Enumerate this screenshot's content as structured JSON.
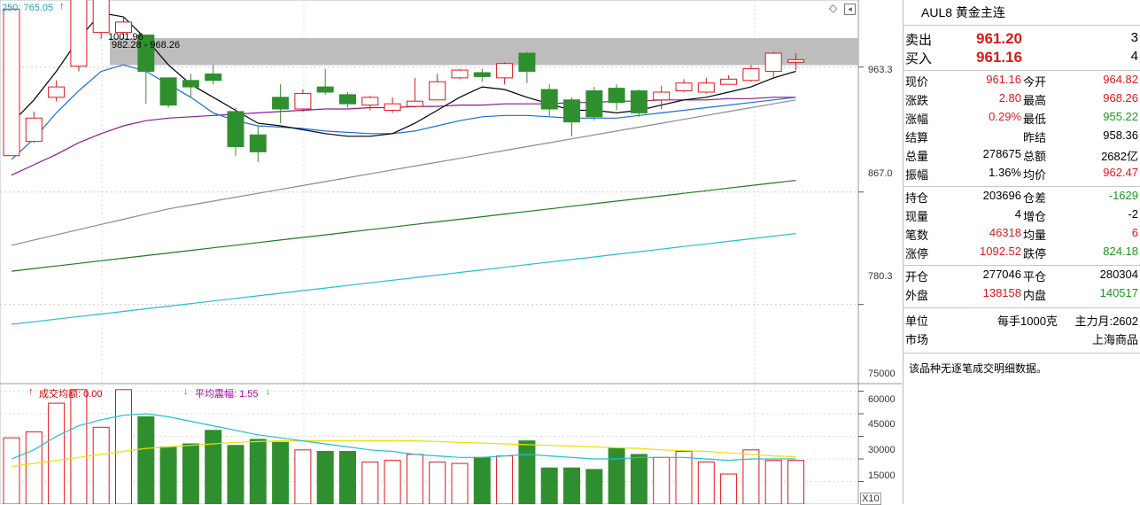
{
  "price_panel": {
    "corner_text": "250: 765.05",
    "peak_label": "1001.96",
    "range_label": "982.28 - 968.26",
    "y_ticks": [
      "963.3",
      "867.0",
      "780.3"
    ]
  },
  "volume_panel": {
    "label_turnover": "成交均额: 0.00",
    "label_amplitude": "平均震幅: 1.55",
    "y_ticks": [
      "75000",
      "60000",
      "45000",
      "30000",
      "15000"
    ],
    "multiplier": "X10"
  },
  "quote": {
    "title": "AUL8  黄金主连",
    "sell_label": "卖出",
    "sell_price": "961.20",
    "sell_qty": "3",
    "buy_label": "买入",
    "buy_price": "961.16",
    "buy_qty": "4",
    "rows1": [
      {
        "l1": "现价",
        "v1": "961.16",
        "c1": "red",
        "l2": "今开",
        "v2": "964.82",
        "c2": "red"
      },
      {
        "l1": "涨跌",
        "v1": "2.80",
        "c1": "red",
        "l2": "最高",
        "v2": "968.26",
        "c2": "red"
      },
      {
        "l1": "涨幅",
        "v1": "0.29%",
        "c1": "red",
        "l2": "最低",
        "v2": "955.22",
        "c2": "green"
      },
      {
        "l1": "结算",
        "v1": "",
        "c1": "",
        "l2": "昨结",
        "v2": "958.36",
        "c2": ""
      },
      {
        "l1": "总量",
        "v1": "278675",
        "c1": "",
        "l2": "总额",
        "v2": "2682亿",
        "c2": ""
      },
      {
        "l1": "振幅",
        "v1": "1.36%",
        "c1": "",
        "l2": "均价",
        "v2": "962.47",
        "c2": "red"
      }
    ],
    "rows2": [
      {
        "l1": "持仓",
        "v1": "203696",
        "c1": "",
        "l2": "仓差",
        "v2": "-1629",
        "c2": "green"
      },
      {
        "l1": "现量",
        "v1": "4",
        "c1": "",
        "l2": "增仓",
        "v2": "-2",
        "c2": ""
      },
      {
        "l1": "笔数",
        "v1": "46318",
        "c1": "red",
        "l2": "均量",
        "v2": "6",
        "c2": "red"
      },
      {
        "l1": "涨停",
        "v1": "1092.52",
        "c1": "red",
        "l2": "跌停",
        "v2": "824.18",
        "c2": "green"
      }
    ],
    "rows3": [
      {
        "l1": "开仓",
        "v1": "277046",
        "c1": "",
        "l2": "平仓",
        "v2": "280304",
        "c2": ""
      },
      {
        "l1": "外盘",
        "v1": "138158",
        "c1": "red",
        "l2": "内盘",
        "v2": "140517",
        "c2": "green"
      }
    ],
    "unit_label": "单位",
    "unit_value": "每手1000克",
    "main_month": "主力月:2602",
    "market_label": "市场",
    "market_value": "上海商品",
    "note": "该品种无逐笔成交明细数据。"
  },
  "chart_data": {
    "type": "candlestick",
    "y_range": [
      720,
      1015
    ],
    "candles": [
      [
        895,
        1008,
        1008,
        895
      ],
      [
        906,
        924,
        929,
        905
      ],
      [
        940,
        948,
        953,
        937
      ],
      [
        964,
        1040,
        1042,
        960
      ],
      [
        990,
        1025,
        1029,
        985
      ],
      [
        990,
        998,
        1002,
        985
      ],
      [
        988,
        960,
        960,
        935
      ],
      [
        955,
        934,
        934,
        932
      ],
      [
        953,
        948,
        958,
        940
      ],
      [
        958,
        953,
        965,
        950
      ],
      [
        929,
        902,
        932,
        895
      ],
      [
        911,
        898,
        918,
        890
      ],
      [
        940,
        931,
        950,
        920
      ],
      [
        931,
        943,
        946,
        929
      ],
      [
        948,
        944,
        962,
        942
      ],
      [
        942,
        935,
        944,
        932
      ],
      [
        934,
        940,
        941,
        930
      ],
      [
        930,
        935,
        940,
        928
      ],
      [
        933,
        937,
        955,
        932
      ],
      [
        938,
        952,
        958,
        938
      ],
      [
        955,
        961,
        962,
        954
      ],
      [
        959,
        956,
        962,
        952
      ],
      [
        955,
        966,
        967,
        950
      ],
      [
        974,
        960,
        975,
        951
      ],
      [
        946,
        931,
        950,
        925
      ],
      [
        938,
        921,
        940,
        910
      ],
      [
        945,
        925,
        948,
        922
      ],
      [
        947,
        936,
        950,
        930
      ],
      [
        945,
        928,
        946,
        925
      ],
      [
        938,
        944,
        949,
        931
      ],
      [
        945,
        951,
        954,
        944
      ],
      [
        944,
        951,
        955,
        943
      ],
      [
        950,
        954,
        957,
        951
      ],
      [
        953,
        962,
        965,
        952
      ],
      [
        960,
        974,
        975,
        954
      ],
      [
        967,
        969,
        974,
        961
      ]
    ],
    "ma_short": [
      920,
      938,
      960,
      985,
      1005,
      1002,
      985,
      965,
      950,
      940,
      930,
      920,
      918,
      915,
      912,
      910,
      910,
      912,
      920,
      930,
      940,
      948,
      946,
      940,
      935,
      930,
      930,
      928,
      930,
      934,
      938,
      940,
      944,
      948,
      955,
      960
    ],
    "ma_mid": [
      892,
      908,
      928,
      945,
      960,
      965,
      960,
      950,
      940,
      928,
      922,
      918,
      917,
      916,
      914,
      913,
      912,
      912,
      914,
      918,
      922,
      925,
      926,
      926,
      925,
      924,
      924,
      924,
      926,
      928,
      930,
      932,
      934,
      936,
      938,
      940
    ],
    "ma_long": [
      880,
      888,
      896,
      905,
      912,
      918,
      922,
      924,
      925,
      926,
      927,
      928,
      929,
      930,
      931,
      931,
      932,
      932,
      933,
      933,
      934,
      934,
      935,
      935,
      935,
      936,
      936,
      937,
      937,
      938,
      938,
      938,
      939,
      939,
      940,
      940
    ],
    "ma_120": [
      826,
      830,
      834,
      838,
      842,
      846,
      850,
      854,
      857,
      860,
      863,
      866,
      869,
      872,
      875,
      878,
      881,
      884,
      887,
      890,
      893,
      896,
      899,
      902,
      905,
      908,
      911,
      914,
      917,
      920,
      923,
      926,
      929,
      932,
      935,
      938
    ],
    "ma_180": [
      806,
      808,
      810,
      812,
      814,
      816,
      818,
      820,
      822,
      824,
      826,
      828,
      830,
      832,
      834,
      836,
      838,
      840,
      842,
      844,
      846,
      848,
      850,
      852,
      854,
      856,
      858,
      860,
      862,
      864,
      866,
      868,
      870,
      872,
      874,
      876
    ],
    "ma_250": [
      765.05,
      767,
      769,
      771,
      773,
      775,
      777,
      779,
      781,
      783,
      785,
      787,
      789,
      791,
      793,
      795,
      797,
      799,
      801,
      803,
      805,
      807,
      809,
      811,
      813,
      815,
      817,
      819,
      821,
      823,
      825,
      827,
      829,
      831,
      833,
      835
    ],
    "volume": [
      44000,
      48000,
      67000,
      76000,
      51000,
      76000,
      58000,
      38000,
      40000,
      49000,
      39000,
      43000,
      41000,
      36000,
      35000,
      35000,
      28000,
      29000,
      33000,
      28000,
      27000,
      31000,
      32000,
      42000,
      24000,
      24000,
      23000,
      37000,
      33000,
      31000,
      35000,
      28000,
      20000,
      36000,
      29000,
      29000
    ],
    "volume_ma_fast": [
      30000,
      36000,
      45000,
      52000,
      56000,
      59000,
      60000,
      58000,
      55000,
      52000,
      49000,
      46000,
      44000,
      42000,
      40000,
      38000,
      36000,
      35000,
      33000,
      32000,
      31000,
      31000,
      32000,
      33000,
      32000,
      31000,
      30000,
      30000,
      31000,
      31000,
      31000,
      30000,
      29000,
      30000,
      30000,
      30000
    ],
    "volume_ma_slow": [
      25000,
      27000,
      29000,
      31000,
      33000,
      35000,
      37000,
      38000,
      39000,
      40000,
      41000,
      41500,
      42000,
      42000,
      42000,
      42000,
      42000,
      42000,
      42000,
      41500,
      41000,
      40500,
      40000,
      39500,
      39000,
      38500,
      38000,
      37500,
      37000,
      36000,
      35500,
      35000,
      34000,
      33000,
      32000,
      31500
    ],
    "volume_range": [
      0,
      80000
    ]
  },
  "colors": {
    "up": "#e01818",
    "down": "#2f8f2f",
    "ma_short": "#000000",
    "ma_mid": "#1a6fd6",
    "ma_long": "#8b1a8b",
    "ma_120": "#8c8c8c",
    "ma_180": "#1f7a1f",
    "ma_250": "#20c0d0",
    "vol_fast": "#20c0d0",
    "vol_slow": "#e8e000"
  }
}
